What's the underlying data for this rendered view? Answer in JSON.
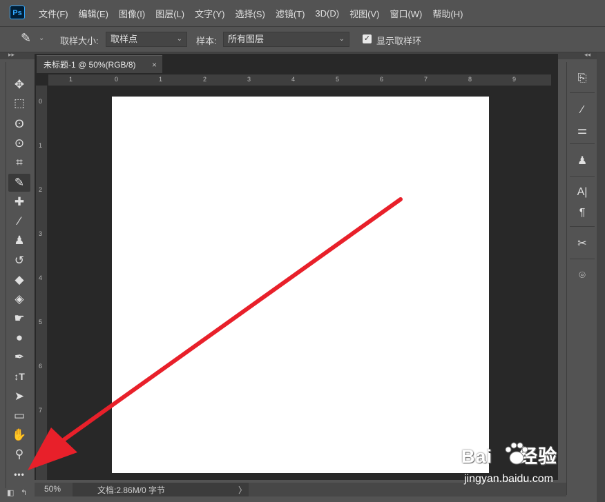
{
  "app": {
    "logo": "Ps"
  },
  "menubar": {
    "items": [
      "文件(F)",
      "编辑(E)",
      "图像(I)",
      "图层(L)",
      "文字(Y)",
      "选择(S)",
      "滤镜(T)",
      "3D(D)",
      "视图(V)",
      "窗口(W)",
      "帮助(H)"
    ]
  },
  "options": {
    "tool_icon": "eyedropper-icon",
    "sample_size_label": "取样大小:",
    "sample_size_value": "取样点",
    "sample_label": "样本:",
    "sample_value": "所有图层",
    "show_ring_label": "显示取样环",
    "show_ring_checked": true
  },
  "document": {
    "tab_title": "未标题-1 @ 50%(RGB/8)",
    "tab_close": "×",
    "ruler_top": [
      "1",
      "0",
      "1",
      "2",
      "3",
      "4",
      "5",
      "6",
      "7",
      "8",
      "9"
    ],
    "ruler_left": [
      "0",
      "1",
      "2",
      "3",
      "4",
      "5",
      "6",
      "7"
    ],
    "canvas_color": "#ffffff"
  },
  "status": {
    "zoom": "50%",
    "doc_info": "文档:2.86M/0 字节",
    "arrow": "〉"
  },
  "tools": [
    {
      "name": "move-tool",
      "glyph": "✥"
    },
    {
      "name": "marquee-tool",
      "glyph": "⬚"
    },
    {
      "name": "lasso-tool",
      "glyph": "ʘ"
    },
    {
      "name": "quick-select-tool",
      "glyph": "⊙"
    },
    {
      "name": "crop-tool",
      "glyph": "⌗"
    },
    {
      "name": "eyedropper-tool",
      "glyph": "✎"
    },
    {
      "name": "healing-brush-tool",
      "glyph": "✚"
    },
    {
      "name": "brush-tool",
      "glyph": "⁄"
    },
    {
      "name": "clone-stamp-tool",
      "glyph": "♟"
    },
    {
      "name": "history-brush-tool",
      "glyph": "↺"
    },
    {
      "name": "eraser-tool",
      "glyph": "◆"
    },
    {
      "name": "paint-bucket-tool",
      "glyph": "◈"
    },
    {
      "name": "smudge-tool",
      "glyph": "☛"
    },
    {
      "name": "dodge-tool",
      "glyph": "●"
    },
    {
      "name": "pen-tool",
      "glyph": "✒"
    },
    {
      "name": "type-tool",
      "glyph": "↕T"
    },
    {
      "name": "path-selection-tool",
      "glyph": "➤"
    },
    {
      "name": "rectangle-tool",
      "glyph": "▭"
    },
    {
      "name": "hand-tool",
      "glyph": "✋"
    },
    {
      "name": "zoom-tool",
      "glyph": "⚲"
    },
    {
      "name": "edit-toolbar-tool",
      "glyph": "•••"
    }
  ],
  "right_panels": [
    {
      "name": "history-panel-icon",
      "glyph": "⎘"
    },
    {
      "name": "brush-settings-icon",
      "glyph": "⁄"
    },
    {
      "name": "brush-presets-icon",
      "glyph": "⚌"
    },
    {
      "name": "clone-source-icon",
      "glyph": "♟"
    },
    {
      "name": "character-panel-icon",
      "glyph": "A|"
    },
    {
      "name": "paragraph-panel-icon",
      "glyph": "¶"
    },
    {
      "name": "tool-presets-icon",
      "glyph": "✂"
    },
    {
      "name": "libraries-icon",
      "glyph": "⌾"
    }
  ],
  "watermark": {
    "brand": "Bai",
    "brand_tail": "经验",
    "url": "jingyan.baidu.com"
  },
  "annotation": {
    "arrow_color": "#e8202a"
  }
}
